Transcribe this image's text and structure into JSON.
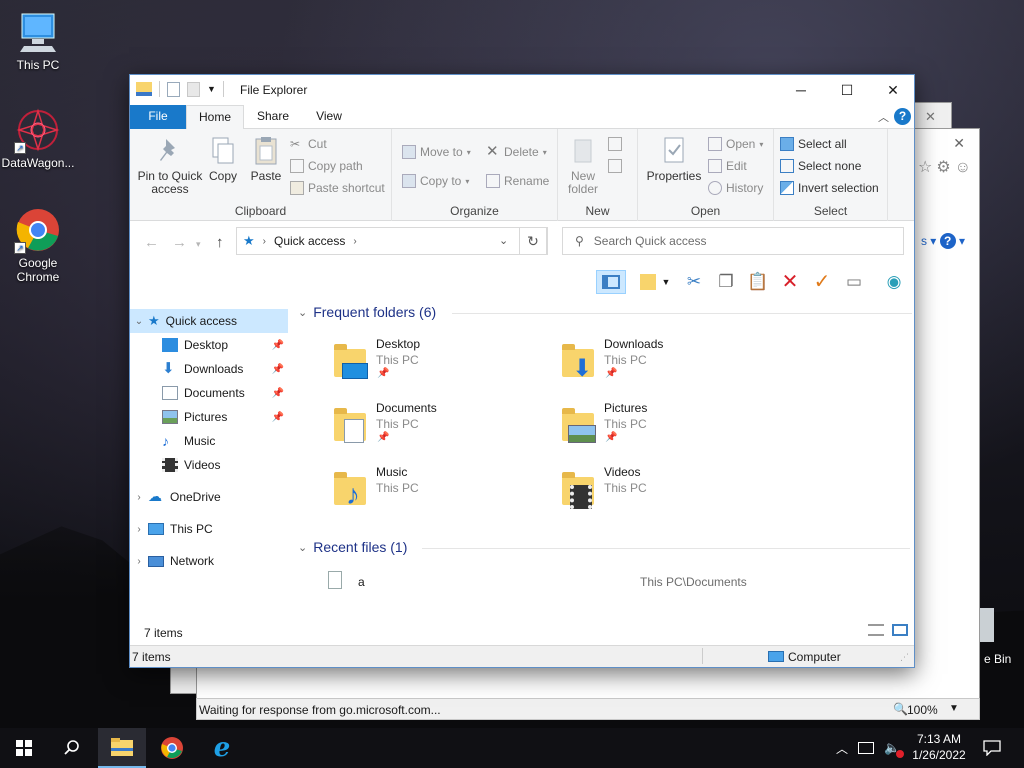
{
  "desktop": {
    "icons": [
      {
        "label": "This PC"
      },
      {
        "label": "DataWagon..."
      },
      {
        "label": "Google\nChrome"
      }
    ],
    "recycle_partial": "e Bin"
  },
  "bg_window": {
    "status_text": "Waiting for response from go.microsoft.com...",
    "zoom": "100%"
  },
  "window": {
    "title": "File Explorer",
    "controls": {
      "minimize": "─",
      "maximize": "☐",
      "close": "✕"
    },
    "tabs": [
      "File",
      "Home",
      "Share",
      "View"
    ],
    "ribbon": {
      "clipboard": {
        "name": "Clipboard",
        "pin": "Pin to Quick\naccess",
        "copy": "Copy",
        "paste": "Paste",
        "cut": "Cut",
        "copy_path": "Copy path",
        "paste_shortcut": "Paste shortcut"
      },
      "organize": {
        "name": "Organize",
        "move_to": "Move to",
        "copy_to": "Copy to",
        "delete": "Delete",
        "rename": "Rename"
      },
      "new": {
        "name": "New",
        "new_folder": "New\nfolder"
      },
      "open": {
        "name": "Open",
        "properties": "Properties",
        "open": "Open",
        "edit": "Edit",
        "history": "History"
      },
      "select": {
        "name": "Select",
        "select_all": "Select all",
        "select_none": "Select none",
        "invert": "Invert selection"
      }
    },
    "address": {
      "crumb": "Quick access",
      "search_placeholder": "Search Quick access"
    },
    "nav": {
      "quick_access": "Quick access",
      "pinned": [
        "Desktop",
        "Downloads",
        "Documents",
        "Pictures"
      ],
      "unpinned": [
        "Music",
        "Videos"
      ],
      "onedrive": "OneDrive",
      "this_pc": "This PC",
      "network": "Network"
    },
    "frequent": {
      "header": "Frequent folders (6)",
      "items": [
        {
          "name": "Desktop",
          "sub": "This PC",
          "pinned": true
        },
        {
          "name": "Downloads",
          "sub": "This PC",
          "pinned": true
        },
        {
          "name": "Documents",
          "sub": "This PC",
          "pinned": true
        },
        {
          "name": "Pictures",
          "sub": "This PC",
          "pinned": true
        },
        {
          "name": "Music",
          "sub": "This PC",
          "pinned": false
        },
        {
          "name": "Videos",
          "sub": "This PC",
          "pinned": false
        }
      ]
    },
    "recent": {
      "header": "Recent files (1)",
      "items": [
        {
          "name": "a",
          "path": "This PC\\Documents"
        }
      ]
    },
    "status": {
      "count": "7 items",
      "count2": "7 items",
      "location": "Computer"
    }
  },
  "taskbar": {
    "time": "7:13 AM",
    "date": "1/26/2022"
  },
  "colors": {
    "accent": "#1979ca",
    "selection": "#cce8ff",
    "folder": "#f8d46c",
    "section_header": "#1e3287"
  }
}
